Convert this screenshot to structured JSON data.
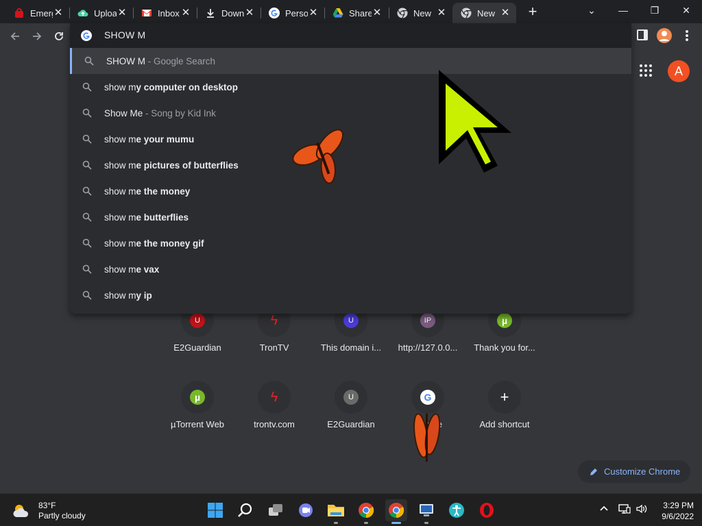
{
  "tabs": [
    {
      "title": "Emerg",
      "icon": "red-bag-icon"
    },
    {
      "title": "Uploa",
      "icon": "cloud-upload-icon"
    },
    {
      "title": "Inbox",
      "icon": "gmail-icon"
    },
    {
      "title": "Down",
      "icon": "download-icon"
    },
    {
      "title": "Perso",
      "icon": "google-icon"
    },
    {
      "title": "Share",
      "icon": "google-drive-icon"
    },
    {
      "title": "New",
      "icon": "chrome-icon"
    },
    {
      "title": "New",
      "icon": "chrome-icon",
      "active": true
    }
  ],
  "omnibox": {
    "input": "SHOW M",
    "suggestions": [
      {
        "prefix": "SHOW M",
        "bold": "",
        "desc": " - Google Search",
        "selected": true
      },
      {
        "prefix": "show m",
        "bold": "y computer on desktop",
        "desc": ""
      },
      {
        "prefix": "Show Me",
        "bold": "",
        "desc": " - Song by Kid Ink"
      },
      {
        "prefix": "show m",
        "bold": "e your mumu",
        "desc": ""
      },
      {
        "prefix": "show m",
        "bold": "e pictures of butterflies",
        "desc": ""
      },
      {
        "prefix": "show m",
        "bold": "e the money",
        "desc": ""
      },
      {
        "prefix": "show m",
        "bold": "e butterflies",
        "desc": ""
      },
      {
        "prefix": "show m",
        "bold": "e the money gif",
        "desc": ""
      },
      {
        "prefix": "show m",
        "bold": "e vax",
        "desc": ""
      },
      {
        "prefix": "show m",
        "bold": "y ip",
        "desc": ""
      }
    ]
  },
  "account": {
    "initial": "A"
  },
  "shortcuts": [
    {
      "label": "E2Guardian",
      "glyph": "U",
      "color": "#c0141a"
    },
    {
      "label": "TronTV",
      "glyph": "ϟ",
      "color": "#e8222a"
    },
    {
      "label": "This domain i...",
      "glyph": "U",
      "color": "#4b3bd8"
    },
    {
      "label": "http://127.0.0...",
      "glyph": "IP",
      "color": "#7a5b7f"
    },
    {
      "label": "Thank you for...",
      "glyph": "µ",
      "color": "#78b82a"
    },
    {
      "label": "µTorrent Web",
      "glyph": "µ",
      "color": "#78b82a"
    },
    {
      "label": "trontv.com",
      "glyph": "ϟ",
      "color": "#e8222a"
    },
    {
      "label": "E2Guardian",
      "glyph": "U",
      "color": "#6a6a6a"
    },
    {
      "label": "Google",
      "glyph": "G",
      "color": "#ffffff"
    },
    {
      "label": "Add shortcut",
      "glyph": "+",
      "color": "#2f3033"
    }
  ],
  "customize": {
    "label": "Customize Chrome"
  },
  "taskbar": {
    "weather_temp": "83°F",
    "weather_desc": "Partly cloudy",
    "time": "3:29 PM",
    "date": "9/6/2022"
  }
}
